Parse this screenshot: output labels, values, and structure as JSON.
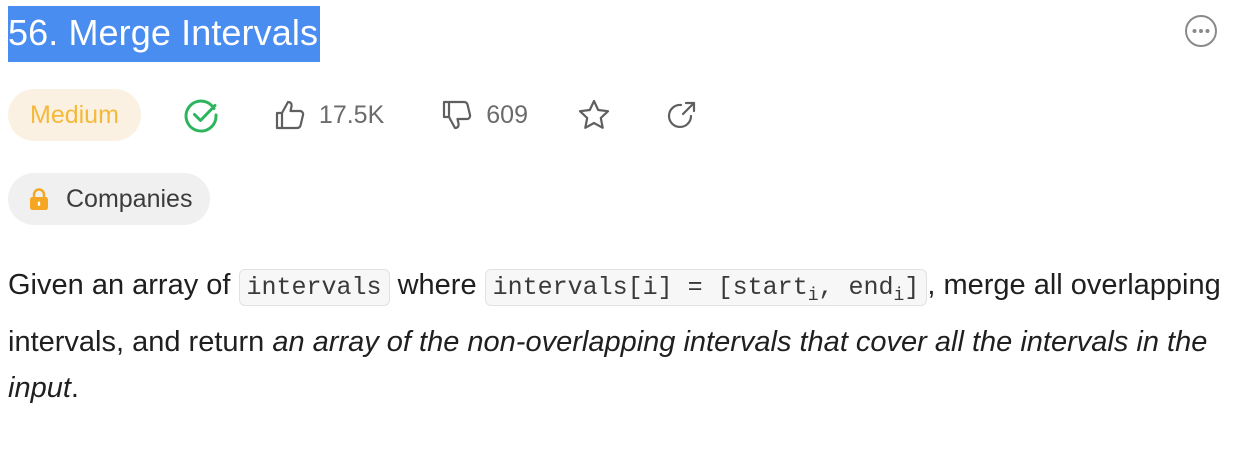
{
  "problem": {
    "title": "56. Merge Intervals",
    "difficulty": "Medium",
    "likes": "17.5K",
    "dislikes": "609",
    "companies_label": "Companies"
  },
  "description": {
    "p1": "Given an array of ",
    "code1": "intervals",
    "p2": " where ",
    "code2_pre": "intervals[i] = [start",
    "code2_sub1": "i",
    "code2_mid": ", end",
    "code2_sub2": "i",
    "code2_post": "]",
    "p3": ", merge all overlapping intervals, and return ",
    "em": "an array of the non-overlapping intervals that cover all the intervals in the input",
    "p4": "."
  },
  "icons": {
    "solved": "check-circle-icon",
    "like": "thumbs-up-icon",
    "dislike": "thumbs-down-icon",
    "favorite": "star-icon",
    "share": "share-icon",
    "more": "more-horizontal-icon",
    "lock": "lock-icon"
  },
  "colors": {
    "title_highlight": "#4a8df0",
    "medium_text": "#f5b93a",
    "medium_bg": "#fbf1e2",
    "solved": "#2db55d",
    "lock": "#f5a623"
  }
}
